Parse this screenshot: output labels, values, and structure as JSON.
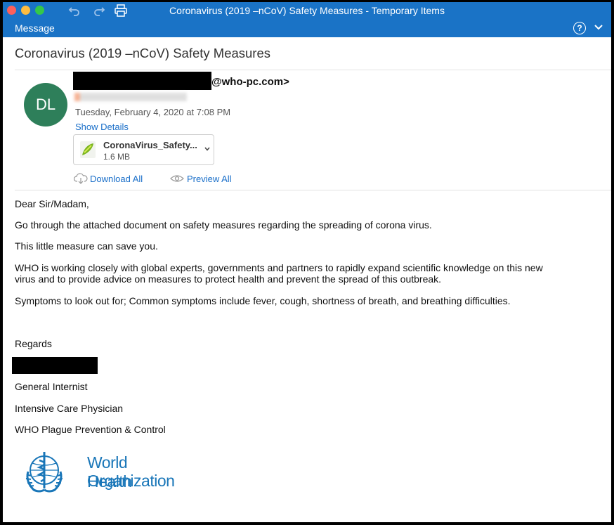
{
  "window": {
    "title": "Coronavirus (2019 –nCoV) Safety Measures - Temporary Items"
  },
  "ribbon": {
    "tab_label": "Message"
  },
  "email": {
    "subject": "Coronavirus (2019 –nCoV) Safety Measures",
    "avatar_initials": "DL",
    "sender_email_suffix": "@who-pc.com>",
    "date": "Tuesday, February 4, 2020 at 7:08 PM",
    "show_details": "Show Details",
    "attachment": {
      "name": "CoronaVirus_Safety...",
      "size": "1.6 MB"
    },
    "download_all": "Download All",
    "preview_all": "Preview All",
    "body": {
      "greeting": "Dear Sir/Madam,",
      "p1": "Go through the attached document on safety measures regarding the spreading of corona virus.",
      "p2": "This little measure can save you.",
      "p3_line1": "WHO is working closely with global experts, governments and partners to rapidly expand scientific knowledge on this new",
      "p3_line2": "virus and to provide advice on measures to protect health and prevent the spread of this outbreak.",
      "p4": "Symptoms to look out for; Common symptoms include fever, cough, shortness of breath, and breathing difficulties.",
      "regards": "Regards",
      "title1": "General Internist",
      "title2": "Intensive Care Physician",
      "title3": "WHO Plague Prevention & Control"
    },
    "logo": {
      "line1": "World Health",
      "line2": "Organization"
    }
  },
  "colors": {
    "accent": "#1a73c6",
    "link": "#1a6fc9",
    "avatar": "#2e7f5a",
    "who_blue": "#1976b8"
  },
  "icons": [
    "undo-icon",
    "redo-icon",
    "print-icon",
    "help-icon",
    "chevron-down-icon",
    "attachment-file-icon",
    "download-icon",
    "preview-eye-icon",
    "who-emblem-icon"
  ]
}
